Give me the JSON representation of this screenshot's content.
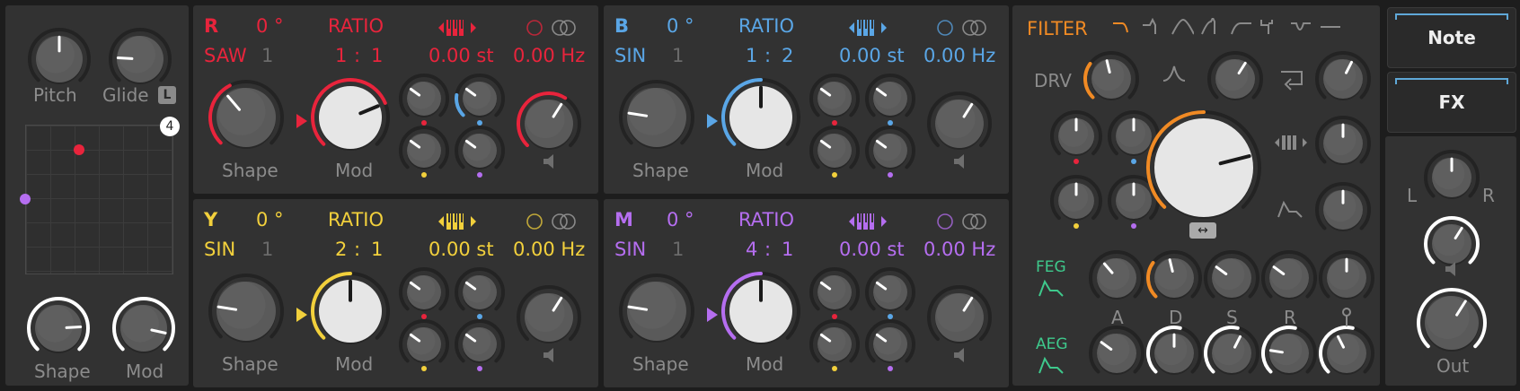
{
  "colors": {
    "red": "#e8243c",
    "blue": "#5aa6e6",
    "yellow": "#f2d03c",
    "purple": "#b56ef0",
    "orange": "#f08a24",
    "green": "#3ec98c",
    "white": "#ffffff",
    "accent_blue": "#5fa8d8"
  },
  "left": {
    "pitch_label": "Pitch",
    "glide_label": "Glide",
    "glide_badge": "L",
    "xy_badge": "4",
    "shape_label": "Shape",
    "mod_label": "Mod"
  },
  "oscillators": [
    {
      "id": "R",
      "letter": "R",
      "phase": "0 °",
      "mode": "RATIO",
      "wave": "SAW",
      "count": "1",
      "ratio_a": "1",
      "ratio_sep": ":",
      "ratio_b": "1",
      "semitones": "0.00 st",
      "hz": "0.00 Hz",
      "shape_label": "Shape",
      "mod_label": "Mod",
      "color": "#e8243c"
    },
    {
      "id": "B",
      "letter": "B",
      "phase": "0 °",
      "mode": "RATIO",
      "wave": "SIN",
      "count": "1",
      "ratio_a": "1",
      "ratio_sep": ":",
      "ratio_b": "2",
      "semitones": "0.00 st",
      "hz": "0.00 Hz",
      "shape_label": "Shape",
      "mod_label": "Mod",
      "color": "#5aa6e6"
    },
    {
      "id": "Y",
      "letter": "Y",
      "phase": "0 °",
      "mode": "RATIO",
      "wave": "SIN",
      "count": "1",
      "ratio_a": "2",
      "ratio_sep": ":",
      "ratio_b": "1",
      "semitones": "0.00 st",
      "hz": "0.00 Hz",
      "shape_label": "Shape",
      "mod_label": "Mod",
      "color": "#f2d03c"
    },
    {
      "id": "M",
      "letter": "M",
      "phase": "0 °",
      "mode": "RATIO",
      "wave": "SIN",
      "count": "1",
      "ratio_a": "4",
      "ratio_sep": ":",
      "ratio_b": "1",
      "semitones": "0.00 st",
      "hz": "0.00 Hz",
      "shape_label": "Shape",
      "mod_label": "Mod",
      "color": "#b56ef0"
    }
  ],
  "filter": {
    "title": "FILTER",
    "drv_label": "DRV",
    "feg_label": "FEG",
    "aeg_label": "AEG",
    "env_labels": [
      "A",
      "D",
      "S",
      "R"
    ],
    "filter_types": [
      "lowpass-icon",
      "lowpass-resonant-icon",
      "bandpass-icon",
      "bandpass-resonant-icon",
      "highpass-icon",
      "highpass-resonant-icon",
      "notch-icon",
      "allpass-icon"
    ]
  },
  "right": {
    "note_label": "Note",
    "fx_label": "FX",
    "pan_l": "L",
    "pan_r": "R",
    "out_label": "Out"
  }
}
